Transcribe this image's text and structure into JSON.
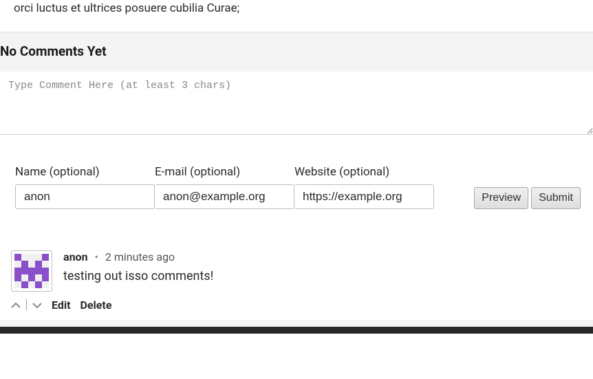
{
  "article": {
    "excerpt": "orci luctus et ultrices posuere cubilia Curae;"
  },
  "comments": {
    "heading": "No Comments Yet",
    "textarea_placeholder": "Type Comment Here (at least 3 chars)",
    "fields": {
      "name": {
        "label": "Name (optional)",
        "value": "anon"
      },
      "email": {
        "label": "E-mail (optional)",
        "value": "anon@example.org"
      },
      "website": {
        "label": "Website (optional)",
        "value": "https://example.org"
      }
    },
    "buttons": {
      "preview": "Preview",
      "submit": "Submit"
    },
    "list": [
      {
        "author": "anon",
        "separator": "•",
        "time": "2 minutes ago",
        "text": "testing out isso comments!",
        "actions": {
          "edit": "Edit",
          "delete": "Delete"
        }
      }
    ]
  }
}
